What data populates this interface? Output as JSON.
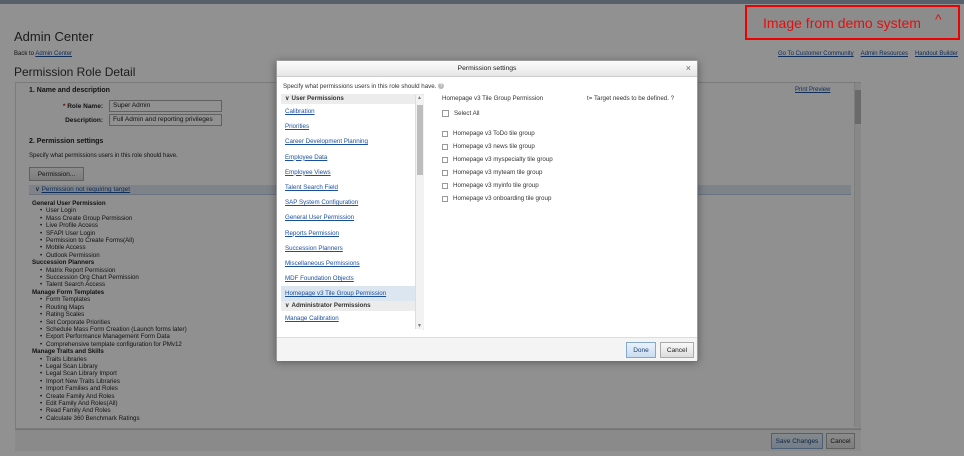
{
  "page": {
    "title": "Admin Center",
    "back_prefix": "Back to",
    "back_link": "Admin Center",
    "top_links": [
      "Go To Customer Community",
      "Admin Resources",
      "Handout Builder"
    ],
    "role_title": "Permission Role Detail"
  },
  "role": {
    "section1": "1. Name and description",
    "print_preview": "Print Preview",
    "name_label": "Role Name:",
    "name_value": "Super Admin",
    "desc_label": "Description:",
    "desc_value": "Full Admin and reporting privileges",
    "section2": "2. Permission settings",
    "perm_desc": "Specify what permissions users in this role should have.",
    "permission_button": "Permission...",
    "not_requiring_target": "Permission not requiring target"
  },
  "perm_tree": [
    {
      "group": "General User Permission",
      "items": [
        "User Login",
        "Mass Create Group Permission",
        "Live Profile Access",
        "SFAPI User Login",
        "Permission to Create Forms(All)",
        "Mobile Access",
        "Outlook Permission"
      ]
    },
    {
      "group": "Succession Planners",
      "items": [
        "Matrix Report Permission",
        "Succession Org Chart Permission",
        "Talent Search Access"
      ]
    },
    {
      "group": "Manage Form Templates",
      "items": [
        "Form Templates",
        "Routing Maps",
        "Rating Scales",
        "Set Corporate Priorities",
        "Schedule Mass Form Creation (Launch forms later)",
        "Export Performance Management Form Data",
        "Comprehensive template configuration for PMv12"
      ]
    },
    {
      "group": "Manage Traits and Skills",
      "items": [
        "Traits Libraries",
        "Legal Scan Library",
        "Legal Scan Library Import",
        "Import New Traits Libraries",
        "Import Families and Roles",
        "Create Family And Roles",
        "Edit Family And Roles(All)",
        "Read Family And Roles",
        "Calculate 360 Benchmark Ratings"
      ]
    }
  ],
  "footer": {
    "save_label": "Save Changes",
    "cancel_label": "Cancel"
  },
  "demo_badge": "Image from demo system",
  "modal": {
    "title": "Permission settings",
    "close": "×",
    "intro": "Specify what permissions users in this role should have.",
    "left": {
      "header_user": "User Permissions",
      "items": [
        "Calibration",
        "Priorities",
        "Career Development Planning",
        "Employee Data",
        "Employee Views",
        "Talent Search Field",
        "SAP System Configuration",
        "General User Permission",
        "Reports Permission",
        "Succession Planners",
        "Miscellaneous Permissions",
        "MDF Foundation Objects",
        "Homepage v3 Tile Group Permission"
      ],
      "selected_index": 12,
      "header_admin": "Administrator Permissions",
      "admin_items": [
        "Manage Calibration"
      ]
    },
    "right": {
      "heading": "Homepage v3 Tile Group Permission",
      "target_note": "t= Target needs to be defined.",
      "select_all": "Select All",
      "options": [
        "Homepage v3 ToDo tile group",
        "Homepage v3 news tile group",
        "Homepage v3 myspecialty tile group",
        "Homepage v3 myteam tile group",
        "Homepage v3 myinfo tile group",
        "Homepage v3 onboarding tile group"
      ]
    },
    "done_label": "Done",
    "cancel_label": "Cancel"
  }
}
